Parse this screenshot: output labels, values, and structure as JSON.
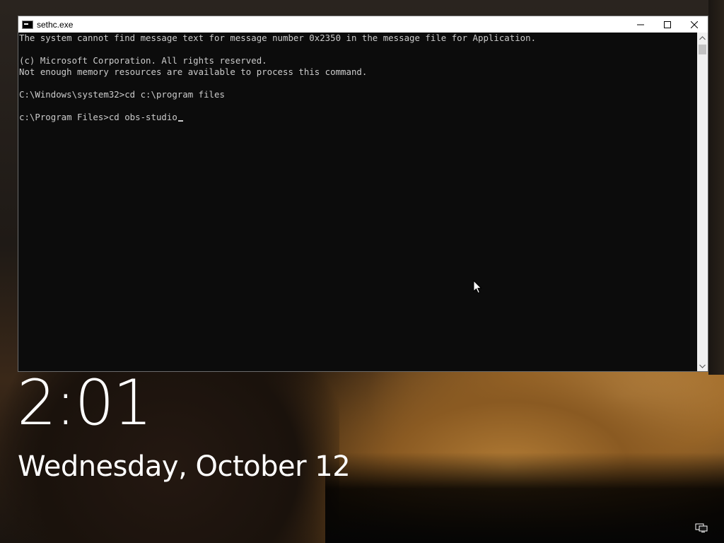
{
  "window": {
    "title": "sethc.exe",
    "controls": {
      "minimize_icon": "minimize-icon",
      "maximize_icon": "maximize-icon",
      "close_icon": "close-icon"
    }
  },
  "console": {
    "lines": [
      "The system cannot find message text for message number 0x2350 in the message file for Application.",
      "",
      "(c) Microsoft Corporation. All rights reserved.",
      "Not enough memory resources are available to process this command.",
      "",
      "C:\\Windows\\system32>cd c:\\program files",
      "",
      "c:\\Program Files>cd obs-studio"
    ],
    "text_color": "#cccccc",
    "background_color": "#0c0c0c"
  },
  "lockscreen": {
    "time": "2:01",
    "date": "Wednesday, October 12"
  },
  "tray": {
    "network_icon": "network-icon"
  }
}
